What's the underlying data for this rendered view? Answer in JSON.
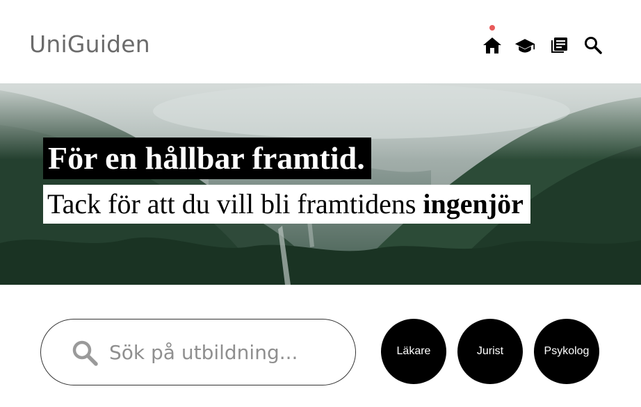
{
  "header": {
    "logo_text": "UniGuiden",
    "nav_icons": [
      "home-icon",
      "graduation-cap-icon",
      "news-icon",
      "search-icon"
    ],
    "active_indicator_color": "#e85a5a"
  },
  "hero": {
    "title": "För en hållbar framtid.",
    "subtitle_prefix": "Tack för att du vill bli framtidens ",
    "subtitle_emphasis": "ingenjör",
    "title_bg": "#000000",
    "subtitle_bg": "#ffffff"
  },
  "search": {
    "placeholder": "Sök på utbildning...",
    "icon": "search-icon"
  },
  "categories": [
    {
      "label": "Läkare"
    },
    {
      "label": "Jurist"
    },
    {
      "label": "Psykolog"
    }
  ]
}
